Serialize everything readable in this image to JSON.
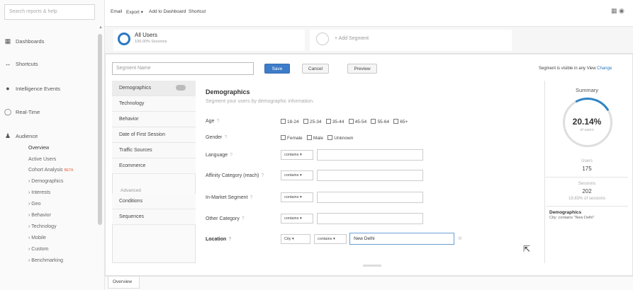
{
  "sidebar": {
    "search_placeholder": "Search reports & help",
    "items": [
      {
        "label": "Dashboards",
        "icon": "grid-icon"
      },
      {
        "label": "Shortcuts",
        "icon": "arrows-icon"
      },
      {
        "label": "Intelligence Events",
        "icon": "pin-icon"
      },
      {
        "label": "Real-Time",
        "icon": "clock-icon"
      },
      {
        "label": "Audience",
        "icon": "people-icon"
      }
    ],
    "audience_sub": [
      "Overview",
      "Active Users",
      "Cohort Analysis",
      "› Demographics",
      "› Interests",
      "› Geo",
      "› Behavior",
      "› Technology",
      "› Mobile",
      "› Custom",
      "› Benchmarking"
    ],
    "cohort_badge": "BETA"
  },
  "toolbar": {
    "email": "Email",
    "export": "Export ▾",
    "add": "Add to Dashboard",
    "shortcut": "Shortcut"
  },
  "segments": {
    "all_title": "All Users",
    "all_sub": "100.00% Sessions",
    "add_label": "+ Add Segment"
  },
  "editor": {
    "name_placeholder": "Segment Name",
    "save": "Save",
    "cancel": "Cancel",
    "preview": "Preview",
    "visibility": "Segment is visible in any View",
    "change": "Change"
  },
  "categories": [
    "Demographics",
    "Technology",
    "Behavior",
    "Date of First Session",
    "Traffic Sources",
    "Ecommerce"
  ],
  "advanced_label": "Advanced",
  "advanced": [
    "Conditions",
    "Sequences"
  ],
  "form": {
    "title": "Demographics",
    "subtitle": "Segment your users by demographic information.",
    "age_label": "Age",
    "age_options": [
      "18-24",
      "25-34",
      "35-44",
      "45-54",
      "55-64",
      "65+"
    ],
    "gender_label": "Gender",
    "gender_options": [
      "Female",
      "Male",
      "Unknown"
    ],
    "language_label": "Language",
    "affinity_label": "Affinity Category (reach)",
    "inmarket_label": "In-Market Segment",
    "other_label": "Other Category",
    "location_label": "Location",
    "contains": "contains",
    "city": "City",
    "location_value": "New Delhi"
  },
  "summary": {
    "title": "Summary",
    "percent": "20.14%",
    "percent_sub": "of users",
    "users_label": "Users",
    "users_value": "175",
    "sessions_label": "Sessions",
    "sessions_value": "202",
    "sessions_sub": "19.83% of sessions",
    "demo_title": "Demographics",
    "demo_desc": "City: contains \"New Delhi\""
  },
  "bottom_tab": "Overview",
  "colors": {
    "accent": "#2f84c6",
    "save": "#3d7cc9"
  }
}
